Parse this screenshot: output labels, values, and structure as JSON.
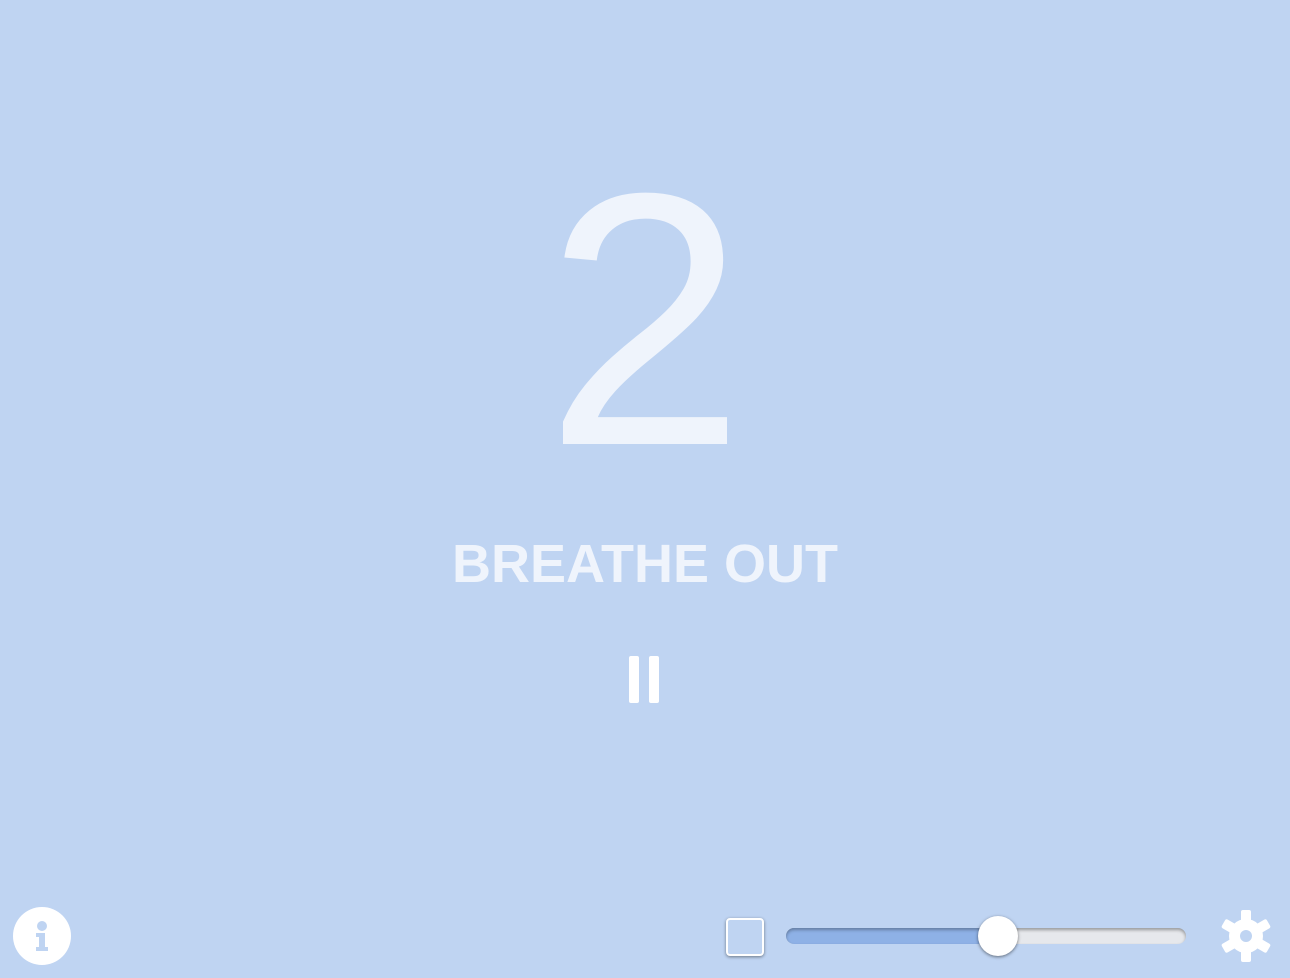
{
  "countdown": {
    "value": "2"
  },
  "phase": {
    "label": "BREATHE OUT"
  },
  "controls": {
    "pause_icon": "pause-icon",
    "info_icon": "info-icon",
    "settings_icon": "gear-icon",
    "mute_checked": false,
    "volume_fraction": 0.53
  },
  "colors": {
    "background": "#bfd4f2",
    "text": "#eff4fc",
    "slider_fill": "#8eb1e6",
    "slider_track": "#e6e8ec"
  }
}
